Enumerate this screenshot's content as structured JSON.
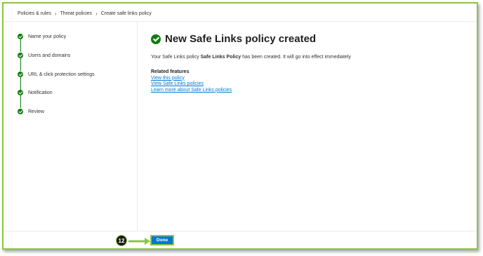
{
  "breadcrumb": {
    "items": [
      "Policies & rules",
      "Threat policies",
      "Create safe links policy"
    ],
    "separator": ">"
  },
  "steps": [
    {
      "label": "Name your policy",
      "status": "complete"
    },
    {
      "label": "Users and domains",
      "status": "complete"
    },
    {
      "label": "URL & click protection settings",
      "status": "complete"
    },
    {
      "label": "Notification",
      "status": "complete"
    },
    {
      "label": "Review",
      "status": "complete"
    }
  ],
  "main": {
    "title": "New Safe Links policy created",
    "desc_prefix": "Your Safe Links policy ",
    "policy_name": "Safe Links Policy",
    "desc_suffix": " has been created. It will go into effect immediately",
    "related_heading": "Related features",
    "links": [
      "View this policy",
      "View Safe Links policies",
      "Learn more about Safe Links policies"
    ]
  },
  "footer": {
    "done_label": "Done"
  },
  "annotation": {
    "step_number": "12"
  },
  "colors": {
    "accent": "#0078d4",
    "success": "#107c10",
    "highlight": "#8cc63f"
  }
}
